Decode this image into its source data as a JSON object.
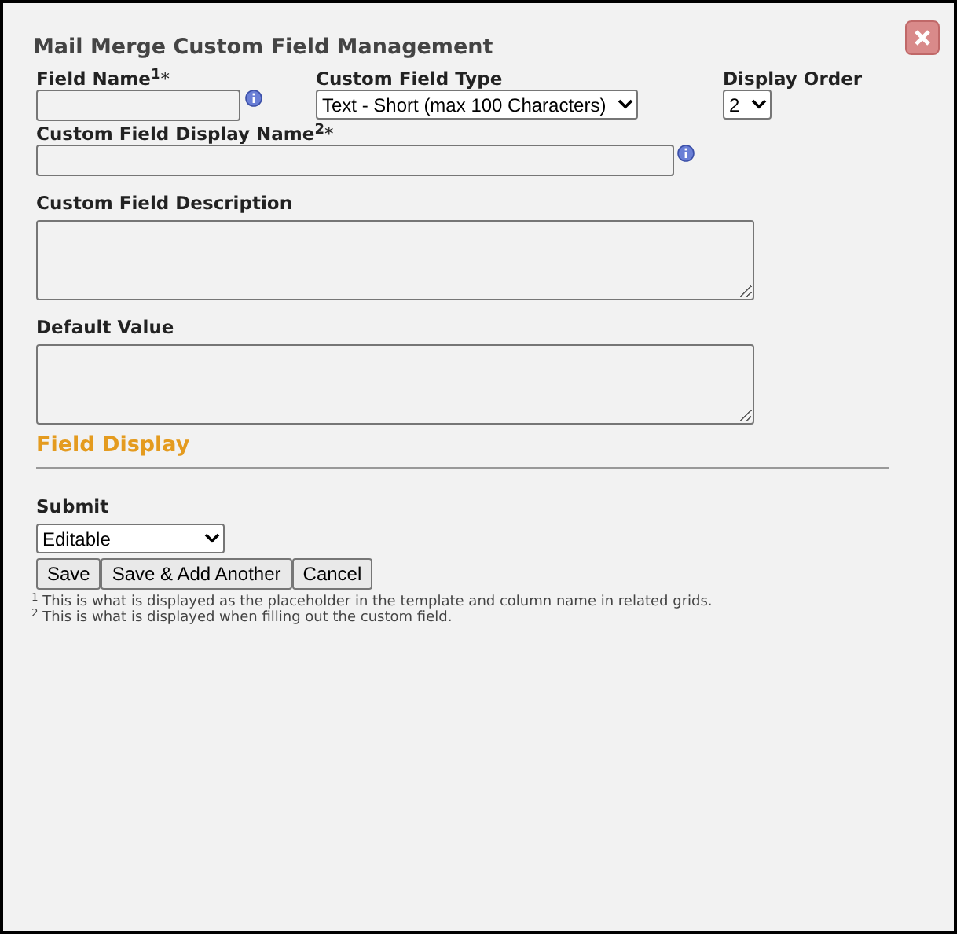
{
  "dialog": {
    "title": "Mail Merge Custom Field Management"
  },
  "field_name": {
    "label": "Field Name",
    "note_mark": "1",
    "required_mark": "*"
  },
  "custom_field_type": {
    "label": "Custom Field Type",
    "value": "Text - Short (max 100 Characters)"
  },
  "display_order": {
    "label": "Display Order",
    "value": "2"
  },
  "display_name": {
    "label": "Custom Field Display Name",
    "note_mark": "2",
    "required_mark": "*"
  },
  "description": {
    "label": "Custom Field Description"
  },
  "default_value": {
    "label": "Default Value"
  },
  "section_heading": "Field Display",
  "submit": {
    "label": "Submit",
    "value": "Editable"
  },
  "buttons": [
    "Save",
    "Save & Add Another",
    "Cancel"
  ],
  "footnotes": [
    {
      "mark": "1",
      "text": "This is what is displayed as the placeholder in the template and column name in related grids."
    },
    {
      "mark": "2",
      "text": "This is what is displayed when filling out the custom field."
    }
  ]
}
